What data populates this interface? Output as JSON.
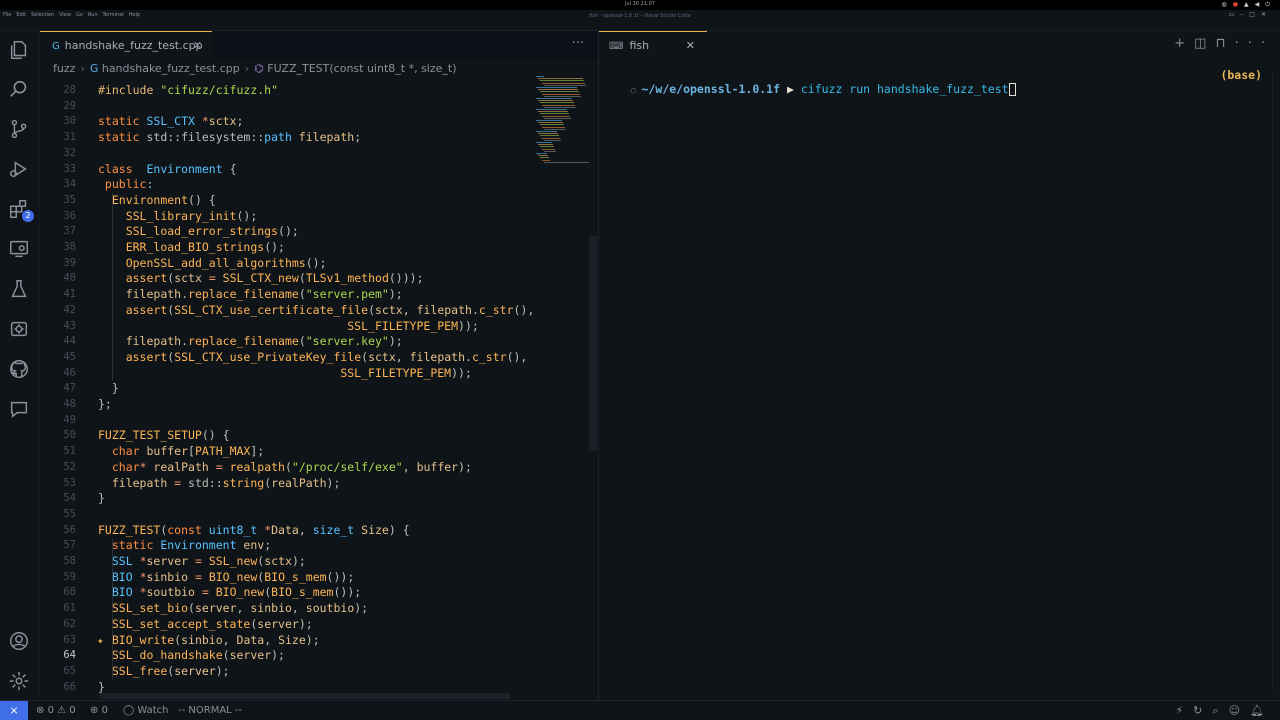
{
  "window": {
    "title": "fish - openssl-1.0.1f - Visual Studio Code",
    "clock": "Jul 30  21:07",
    "menu": [
      "File",
      "Edit",
      "Selection",
      "View",
      "Go",
      "Run",
      "Terminal",
      "Help"
    ]
  },
  "activity": {
    "items": [
      {
        "name": "explorer-icon"
      },
      {
        "name": "search-icon"
      },
      {
        "name": "source-control-icon"
      },
      {
        "name": "run-debug-icon"
      },
      {
        "name": "extensions-icon",
        "badge": "2"
      },
      {
        "name": "remote-explorer-icon"
      },
      {
        "name": "testing-icon"
      },
      {
        "name": "fuzzing-icon"
      },
      {
        "name": "github-icon"
      },
      {
        "name": "comments-icon"
      }
    ],
    "bottom": [
      {
        "name": "account-icon"
      },
      {
        "name": "manage-gear-icon"
      }
    ]
  },
  "editor": {
    "tab_label": "handshake_fuzz_test.cpp",
    "breadcrumb": [
      "fuzz",
      "handshake_fuzz_test.cpp",
      "FUZZ_TEST(const uint8_t *, size_t)"
    ],
    "current_line": 64
  },
  "code": [
    {
      "n": "28",
      "t": [
        [
          "pp",
          "#include "
        ],
        [
          "st",
          "\"cifuzz/cifuzz.h\""
        ]
      ]
    },
    {
      "n": "29",
      "t": []
    },
    {
      "n": "30",
      "t": [
        [
          "kw",
          "static "
        ],
        [
          "ty",
          "SSL_CTX "
        ],
        [
          "op",
          "*"
        ],
        [
          "mc",
          "sctx"
        ],
        [
          "tx",
          ";"
        ]
      ]
    },
    {
      "n": "31",
      "t": [
        [
          "kw",
          "static "
        ],
        [
          "tx",
          "std::filesystem::"
        ],
        [
          "ty",
          "path "
        ],
        [
          "mc",
          "filepath"
        ],
        [
          "tx",
          ";"
        ]
      ]
    },
    {
      "n": "32",
      "t": []
    },
    {
      "n": "33",
      "t": [
        [
          "kw",
          "class "
        ],
        [
          "ty",
          " Environment "
        ],
        [
          "tx",
          "{"
        ]
      ]
    },
    {
      "n": "34",
      "t": [
        [
          "kw",
          " public"
        ],
        [
          "tx",
          ":"
        ]
      ]
    },
    {
      "n": "35",
      "t": [
        [
          "tx",
          "  "
        ],
        [
          "fn",
          "Environment"
        ],
        [
          "tx",
          "() {"
        ]
      ]
    },
    {
      "n": "36",
      "t": [
        [
          "tx",
          "    "
        ],
        [
          "fn",
          "SSL_library_init"
        ],
        [
          "tx",
          "();"
        ]
      ]
    },
    {
      "n": "37",
      "t": [
        [
          "tx",
          "    "
        ],
        [
          "fn",
          "SSL_load_error_strings"
        ],
        [
          "tx",
          "();"
        ]
      ]
    },
    {
      "n": "38",
      "t": [
        [
          "tx",
          "    "
        ],
        [
          "fn",
          "ERR_load_BIO_strings"
        ],
        [
          "tx",
          "();"
        ]
      ]
    },
    {
      "n": "39",
      "t": [
        [
          "tx",
          "    "
        ],
        [
          "fn",
          "OpenSSL_add_all_algorithms"
        ],
        [
          "tx",
          "();"
        ]
      ]
    },
    {
      "n": "40",
      "t": [
        [
          "tx",
          "    "
        ],
        [
          "fn",
          "assert"
        ],
        [
          "tx",
          "("
        ],
        [
          "mc",
          "sctx "
        ],
        [
          "op",
          "= "
        ],
        [
          "fn",
          "SSL_CTX_new"
        ],
        [
          "tx",
          "("
        ],
        [
          "fn",
          "TLSv1_method"
        ],
        [
          "tx",
          "()));"
        ]
      ]
    },
    {
      "n": "41",
      "t": [
        [
          "tx",
          "    "
        ],
        [
          "mc",
          "filepath"
        ],
        [
          "tx",
          "."
        ],
        [
          "fn",
          "replace_filename"
        ],
        [
          "tx",
          "("
        ],
        [
          "st",
          "\"server.pem\""
        ],
        [
          "tx",
          ");"
        ]
      ]
    },
    {
      "n": "42",
      "t": [
        [
          "tx",
          "    "
        ],
        [
          "fn",
          "assert"
        ],
        [
          "tx",
          "("
        ],
        [
          "fn",
          "SSL_CTX_use_certificate_file"
        ],
        [
          "tx",
          "("
        ],
        [
          "mc",
          "sctx"
        ],
        [
          "tx",
          ", "
        ],
        [
          "mc",
          "filepath"
        ],
        [
          "tx",
          "."
        ],
        [
          "fn",
          "c_str"
        ],
        [
          "tx",
          "(),"
        ]
      ]
    },
    {
      "n": "43",
      "t": [
        [
          "tx",
          "                                    "
        ],
        [
          "fn",
          "SSL_FILETYPE_PEM"
        ],
        [
          "tx",
          "));"
        ]
      ]
    },
    {
      "n": "44",
      "t": [
        [
          "tx",
          "    "
        ],
        [
          "mc",
          "filepath"
        ],
        [
          "tx",
          "."
        ],
        [
          "fn",
          "replace_filename"
        ],
        [
          "tx",
          "("
        ],
        [
          "st",
          "\"server.key\""
        ],
        [
          "tx",
          ");"
        ]
      ]
    },
    {
      "n": "45",
      "t": [
        [
          "tx",
          "    "
        ],
        [
          "fn",
          "assert"
        ],
        [
          "tx",
          "("
        ],
        [
          "fn",
          "SSL_CTX_use_PrivateKey_file"
        ],
        [
          "tx",
          "("
        ],
        [
          "mc",
          "sctx"
        ],
        [
          "tx",
          ", "
        ],
        [
          "mc",
          "filepath"
        ],
        [
          "tx",
          "."
        ],
        [
          "fn",
          "c_str"
        ],
        [
          "tx",
          "(),"
        ]
      ]
    },
    {
      "n": "46",
      "t": [
        [
          "tx",
          "                                   "
        ],
        [
          "fn",
          "SSL_FILETYPE_PEM"
        ],
        [
          "tx",
          "));"
        ]
      ]
    },
    {
      "n": "47",
      "t": [
        [
          "tx",
          "  }"
        ]
      ]
    },
    {
      "n": "48",
      "t": [
        [
          "tx",
          "};"
        ]
      ]
    },
    {
      "n": "49",
      "t": []
    },
    {
      "n": "50",
      "t": [
        [
          "fn",
          "FUZZ_TEST_SETUP"
        ],
        [
          "tx",
          "() {"
        ]
      ]
    },
    {
      "n": "51",
      "t": [
        [
          "tx",
          "  "
        ],
        [
          "kw",
          "char "
        ],
        [
          "mc",
          "buffer"
        ],
        [
          "tx",
          "["
        ],
        [
          "fn",
          "PATH_MAX"
        ],
        [
          "tx",
          "];"
        ]
      ]
    },
    {
      "n": "52",
      "t": [
        [
          "tx",
          "  "
        ],
        [
          "kw",
          "char"
        ],
        [
          "op",
          "* "
        ],
        [
          "mc",
          "realPath "
        ],
        [
          "op",
          "= "
        ],
        [
          "fn",
          "realpath"
        ],
        [
          "tx",
          "("
        ],
        [
          "st",
          "\"/proc/self/exe\""
        ],
        [
          "tx",
          ", "
        ],
        [
          "mc",
          "buffer"
        ],
        [
          "tx",
          ");"
        ]
      ]
    },
    {
      "n": "53",
      "t": [
        [
          "tx",
          "  "
        ],
        [
          "mc",
          "filepath "
        ],
        [
          "op",
          "= "
        ],
        [
          "tx",
          "std::"
        ],
        [
          "fn",
          "string"
        ],
        [
          "tx",
          "("
        ],
        [
          "mc",
          "realPath"
        ],
        [
          "tx",
          ");"
        ]
      ]
    },
    {
      "n": "54",
      "t": [
        [
          "tx",
          "}"
        ]
      ]
    },
    {
      "n": "55",
      "t": []
    },
    {
      "n": "56",
      "t": [
        [
          "fn",
          "FUZZ_TEST"
        ],
        [
          "tx",
          "("
        ],
        [
          "kw",
          "const "
        ],
        [
          "ty",
          "uint8_t "
        ],
        [
          "op",
          "*"
        ],
        [
          "mc",
          "Data"
        ],
        [
          "tx",
          ", "
        ],
        [
          "ty",
          "size_t "
        ],
        [
          "mc",
          "Size"
        ],
        [
          "tx",
          ") {"
        ]
      ]
    },
    {
      "n": "57",
      "t": [
        [
          "tx",
          "  "
        ],
        [
          "kw",
          "static "
        ],
        [
          "ty",
          "Environment "
        ],
        [
          "mc",
          "env"
        ],
        [
          "tx",
          ";"
        ]
      ]
    },
    {
      "n": "58",
      "t": [
        [
          "tx",
          "  "
        ],
        [
          "ty",
          "SSL "
        ],
        [
          "op",
          "*"
        ],
        [
          "mc",
          "server "
        ],
        [
          "op",
          "= "
        ],
        [
          "fn",
          "SSL_new"
        ],
        [
          "tx",
          "("
        ],
        [
          "mc",
          "sctx"
        ],
        [
          "tx",
          ");"
        ]
      ]
    },
    {
      "n": "59",
      "t": [
        [
          "tx",
          "  "
        ],
        [
          "ty",
          "BIO "
        ],
        [
          "op",
          "*"
        ],
        [
          "mc",
          "sinbio "
        ],
        [
          "op",
          "= "
        ],
        [
          "fn",
          "BIO_new"
        ],
        [
          "tx",
          "("
        ],
        [
          "fn",
          "BIO_s_mem"
        ],
        [
          "tx",
          "());"
        ]
      ]
    },
    {
      "n": "60",
      "t": [
        [
          "tx",
          "  "
        ],
        [
          "ty",
          "BIO "
        ],
        [
          "op",
          "*"
        ],
        [
          "mc",
          "soutbio "
        ],
        [
          "op",
          "= "
        ],
        [
          "fn",
          "BIO_new"
        ],
        [
          "tx",
          "("
        ],
        [
          "fn",
          "BIO_s_mem"
        ],
        [
          "tx",
          "());"
        ]
      ]
    },
    {
      "n": "61",
      "t": [
        [
          "tx",
          "  "
        ],
        [
          "fn",
          "SSL_set_bio"
        ],
        [
          "tx",
          "("
        ],
        [
          "mc",
          "server"
        ],
        [
          "tx",
          ", "
        ],
        [
          "mc",
          "sinbio"
        ],
        [
          "tx",
          ", "
        ],
        [
          "mc",
          "soutbio"
        ],
        [
          "tx",
          ");"
        ]
      ]
    },
    {
      "n": "62",
      "t": [
        [
          "tx",
          "  "
        ],
        [
          "fn",
          "SSL_set_accept_state"
        ],
        [
          "tx",
          "("
        ],
        [
          "mc",
          "server"
        ],
        [
          "tx",
          ");"
        ]
      ]
    },
    {
      "n": "63",
      "t": [
        [
          "tx",
          "  "
        ],
        [
          "fn",
          "BIO_write"
        ],
        [
          "tx",
          "("
        ],
        [
          "mc",
          "sinbio"
        ],
        [
          "tx",
          ", "
        ],
        [
          "mc",
          "Data"
        ],
        [
          "tx",
          ", "
        ],
        [
          "mc",
          "Size"
        ],
        [
          "tx",
          ");"
        ]
      ],
      "spark": true
    },
    {
      "n": "64",
      "t": [
        [
          "tx",
          "  "
        ],
        [
          "fn",
          "SSL_do_handshake"
        ],
        [
          "tx",
          "("
        ],
        [
          "mc",
          "server"
        ],
        [
          "tx",
          ");"
        ]
      ]
    },
    {
      "n": "65",
      "t": [
        [
          "tx",
          "  "
        ],
        [
          "fn",
          "SSL_free"
        ],
        [
          "tx",
          "("
        ],
        [
          "mc",
          "server"
        ],
        [
          "tx",
          ");"
        ]
      ]
    },
    {
      "n": "66",
      "t": [
        [
          "tx",
          "}"
        ]
      ]
    }
  ],
  "terminal": {
    "tab_label": "fish",
    "cwd": "~/w/e/openssl-1.0.1f",
    "arrow": "▶",
    "command": "cifuzz run handshake_fuzz_test",
    "env": "(base)"
  },
  "status": {
    "errors": "0",
    "warnings": "0",
    "ports": "0",
    "watch": "Watch",
    "mode": "-- NORMAL --"
  }
}
